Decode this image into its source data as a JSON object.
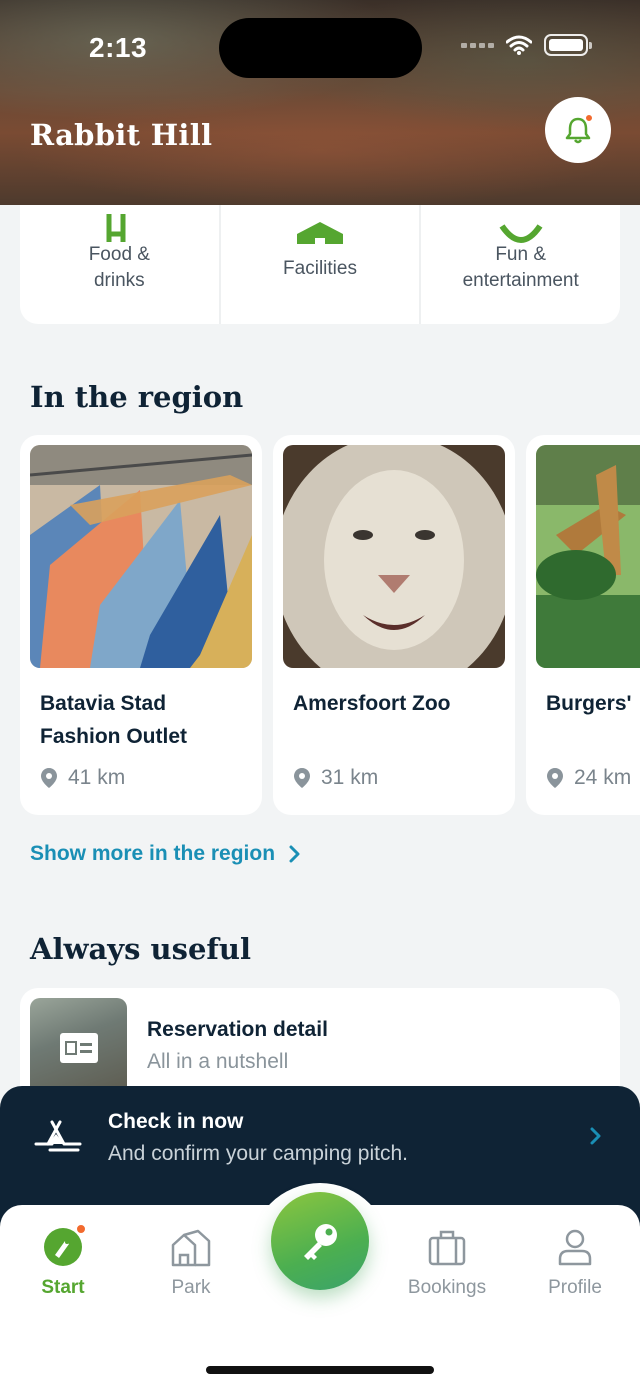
{
  "status_bar": {
    "time": "2:13"
  },
  "header": {
    "title": "Rabbit Hill"
  },
  "categories": [
    {
      "label_line1": "Food &",
      "label_line2": "drinks",
      "icon": "fork-icon"
    },
    {
      "label_line1": "Facilities",
      "label_line2": "",
      "icon": "house-icon"
    },
    {
      "label_line1": "Fun &",
      "label_line2": "entertainment",
      "icon": "smile-icon"
    }
  ],
  "region": {
    "title": "In the region",
    "cards": [
      {
        "name": "Batavia Stad Fashion Outlet",
        "distance": "41 km",
        "image": "clothing-rack"
      },
      {
        "name": "Amersfoort Zoo",
        "distance": "31 km",
        "image": "white-lion"
      },
      {
        "name": "Burgers'",
        "distance": "24 km",
        "image": "giraffes"
      }
    ],
    "show_more": "Show more in the region"
  },
  "useful": {
    "title": "Always useful",
    "items": [
      {
        "title": "Reservation detail",
        "subtitle": "All in a nutshell"
      }
    ]
  },
  "checkin": {
    "title": "Check in now",
    "subtitle": "And confirm your camping pitch."
  },
  "tabbar": {
    "tabs": [
      {
        "label": "Start",
        "active": true
      },
      {
        "label": "Park"
      },
      {
        "label": "Bookings"
      },
      {
        "label": "Profile"
      }
    ]
  },
  "colors": {
    "brand_green": "#55a630",
    "link_blue": "#1a8fb5",
    "dark_navy": "#0f2335",
    "notification_orange": "#f26a2e"
  }
}
